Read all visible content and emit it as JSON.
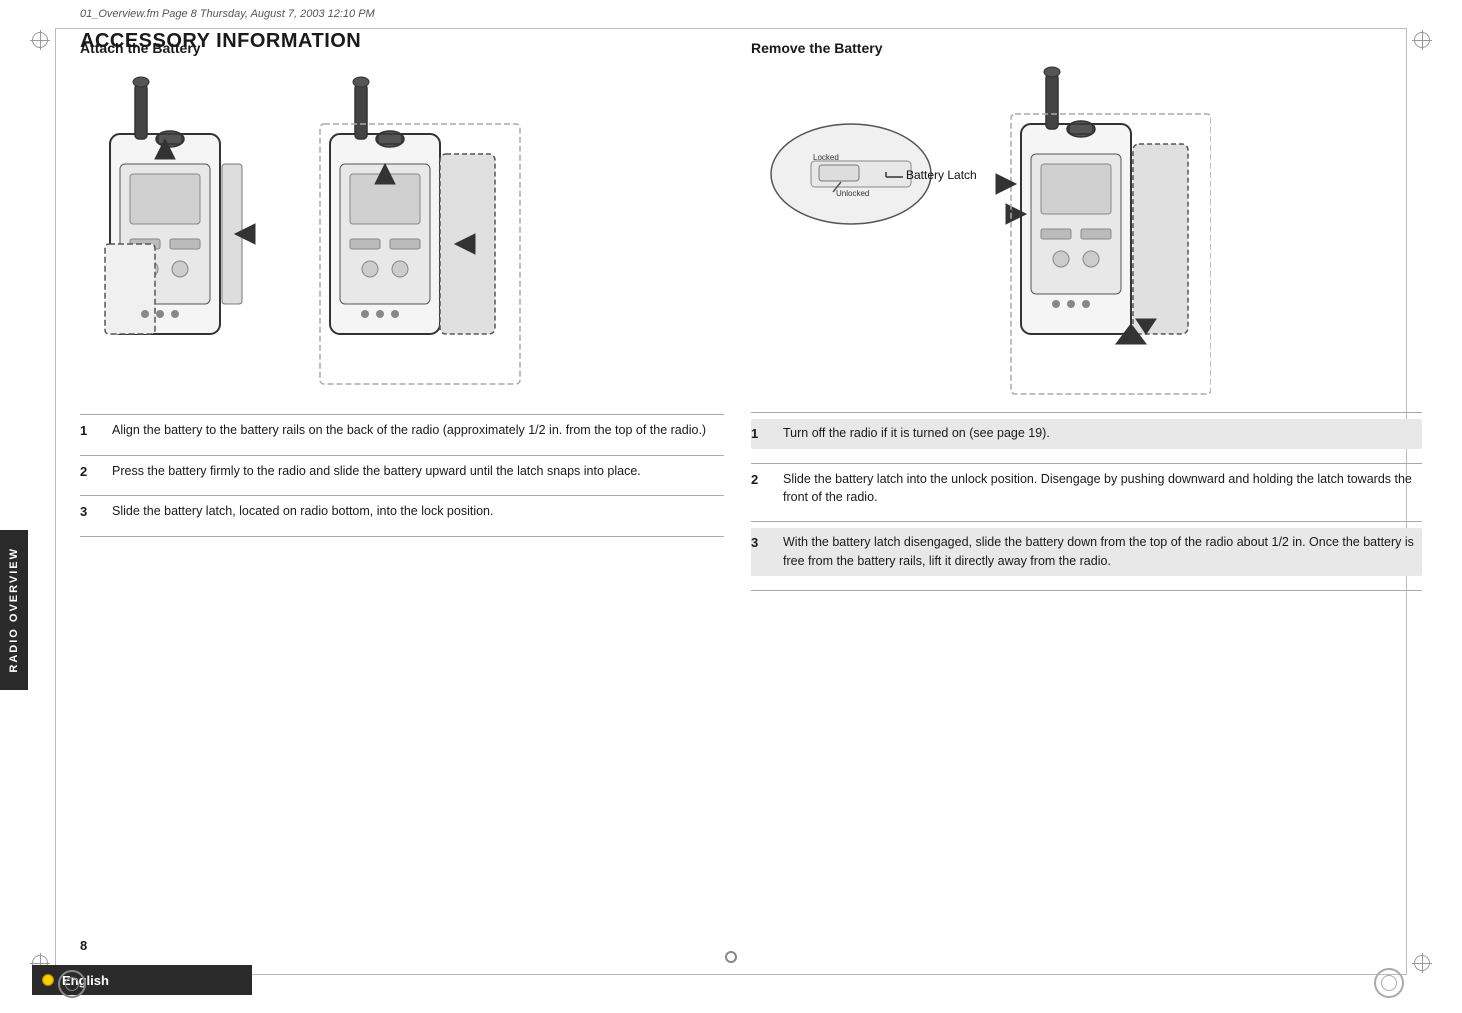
{
  "page": {
    "meta": "01_Overview.fm  Page 8  Thursday, August 7, 2003  12:10 PM",
    "number": "8",
    "side_tab": "RADIO OVERVIEW",
    "bottom_language": "English"
  },
  "main_title": "ACCESSORY INFORMATION",
  "attach_battery": {
    "header": "Attach the Battery",
    "steps": [
      {
        "num": "1",
        "text": "Align the battery to the battery rails on the back of the radio (approximately 1/2 in. from the top of the radio.)"
      },
      {
        "num": "2",
        "text": "Press the battery firmly to the radio and slide the battery upward until the latch snaps into place."
      },
      {
        "num": "3",
        "text": "Slide the battery latch, located on radio bottom, into the lock position."
      }
    ]
  },
  "remove_battery": {
    "header": "Remove the Battery",
    "battery_latch_label": "Battery Latch",
    "latch_locked": "Locked",
    "latch_unlocked": "Unlocked",
    "steps": [
      {
        "num": "1",
        "text": "Turn off the radio if it is turned on (see page 19).",
        "highlighted": true
      },
      {
        "num": "2",
        "text": "Slide the battery latch into the unlock position. Disengage by pushing downward and holding the latch towards the front of the radio.",
        "highlighted": false
      },
      {
        "num": "3",
        "text": "With the battery latch disengaged, slide the battery down from the top of the radio about 1/2 in. Once the battery is free from the battery rails, lift it directly away from the radio.",
        "highlighted": true
      }
    ]
  }
}
